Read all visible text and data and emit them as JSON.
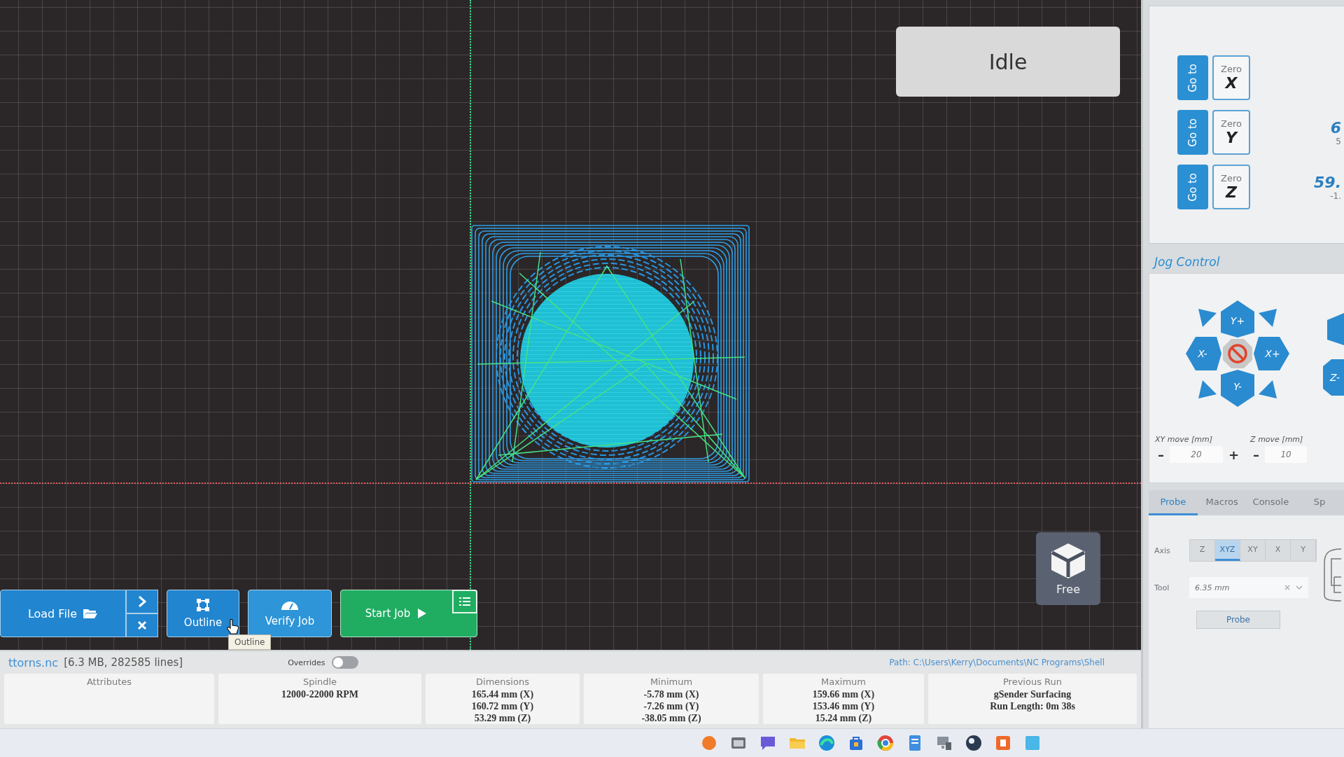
{
  "visualizer": {
    "status": "Idle",
    "view_button": {
      "label": "Free"
    },
    "tooltip": "Outline"
  },
  "toolbar": {
    "load_file": {
      "label": "Load File"
    },
    "outline": {
      "label": "Outline"
    },
    "verify": {
      "label": "Verify Job"
    },
    "start": {
      "label": "Start Job"
    }
  },
  "position": {
    "rows": [
      {
        "axis": "X",
        "go_to": "Go to",
        "zero": "Zero"
      },
      {
        "axis": "Y",
        "go_to": "Go to",
        "zero": "Zero",
        "value": "6",
        "sub_value": "5"
      },
      {
        "axis": "Z",
        "go_to": "Go to",
        "zero": "Zero",
        "value": "59.",
        "sub_value": "-1."
      }
    ]
  },
  "jog": {
    "title": "Jog Control",
    "xy_buttons": [
      {
        "label": "Y+",
        "kind": "up"
      },
      {
        "label": "X-",
        "kind": "left"
      },
      {
        "label": "X+",
        "kind": "right"
      },
      {
        "label": "Y-",
        "kind": "down"
      }
    ],
    "z_buttons": [
      {
        "kind": "up"
      },
      {
        "kind": "down",
        "label": "Z-"
      }
    ],
    "xy_move": {
      "label": "XY move [mm]",
      "minus": "–",
      "value": "20",
      "plus": "+"
    },
    "z_move": {
      "label": "Z move [mm]",
      "minus": "–",
      "value": "10"
    }
  },
  "tabs": [
    {
      "label": "Probe",
      "selected": true
    },
    {
      "label": "Macros",
      "selected": false
    },
    {
      "label": "Console",
      "selected": false
    },
    {
      "label": "Sp",
      "selected": false
    }
  ],
  "probe": {
    "axis_label": "Axis",
    "axes": [
      {
        "label": "Z",
        "selected": false
      },
      {
        "label": "XYZ",
        "selected": true
      },
      {
        "label": "XY",
        "selected": false
      },
      {
        "label": "X",
        "selected": false
      },
      {
        "label": "Y",
        "selected": false
      }
    ],
    "tool_label": "Tool",
    "tool_value": "6.35 mm",
    "button": "Probe"
  },
  "file_info": {
    "name": "ttorns.nc",
    "details": "[6.3 MB, 282585 lines]",
    "overrides": {
      "label": "Overrides",
      "on": false
    },
    "path": "Path: C:\\Users\\Kerry\\Documents\\NC Programs\\Shell",
    "columns": [
      {
        "heading": "Attributes"
      },
      {
        "heading": "Spindle",
        "lines": [
          "12000-22000 RPM"
        ]
      },
      {
        "heading": "Dimensions",
        "lines": [
          "165.44 mm (X)",
          "160.72 mm (Y)",
          "53.29 mm (Z)"
        ]
      },
      {
        "heading": "Minimum",
        "lines": [
          "-5.78 mm (X)",
          "-7.26 mm (Y)",
          "-38.05 mm (Z)"
        ]
      },
      {
        "heading": "Maximum",
        "lines": [
          "159.66 mm (X)",
          "153.46 mm (Y)",
          "15.24 mm (Z)"
        ]
      },
      {
        "heading": "Previous Run",
        "lines": [
          "gSender Surfacing",
          "Run Length: 0m 38s"
        ]
      }
    ]
  }
}
